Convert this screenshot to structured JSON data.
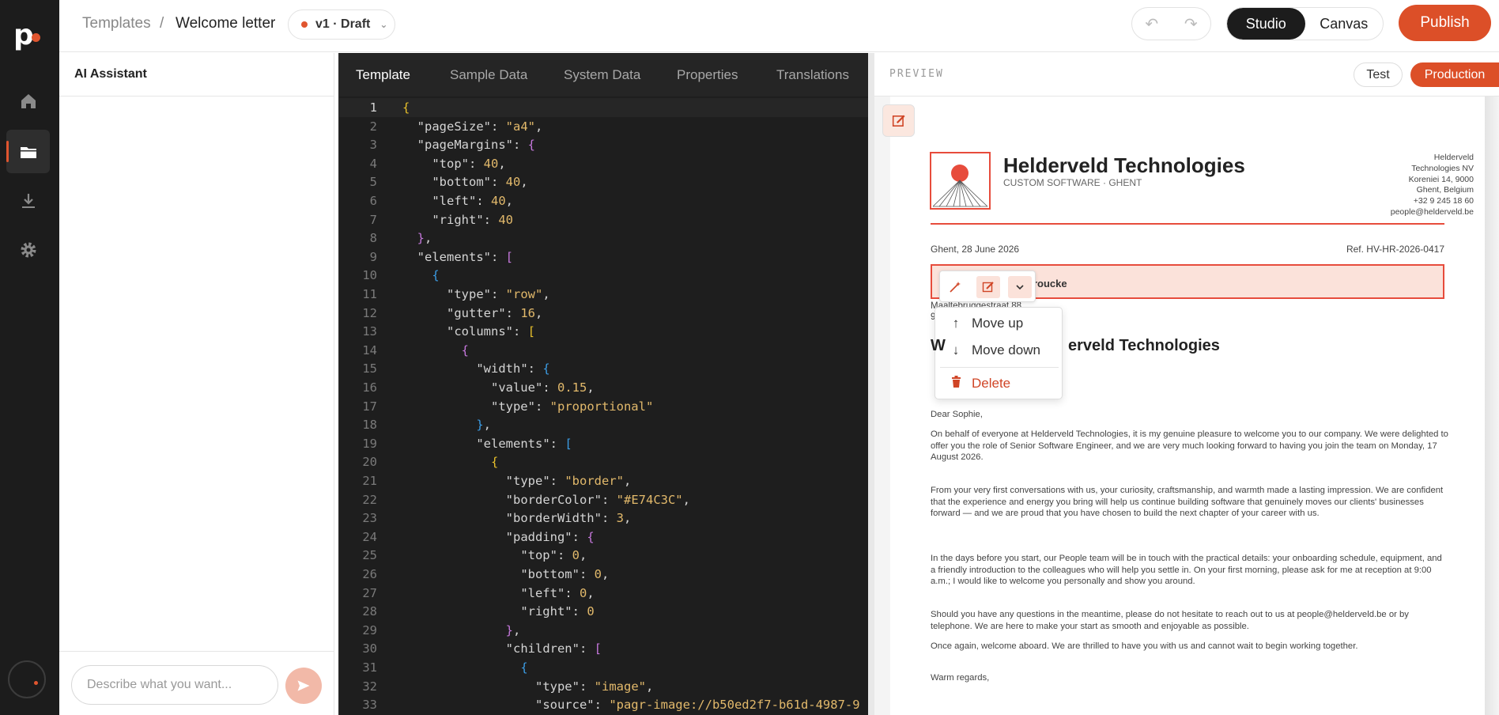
{
  "breadcrumb": {
    "root": "Templates",
    "separator": "/",
    "current": "Welcome letter"
  },
  "version": {
    "label": "v1 · Draft",
    "status_color": "#e0552f"
  },
  "mode_toggle": {
    "studio": "Studio",
    "canvas": "Canvas",
    "active": "Studio"
  },
  "publish_label": "Publish",
  "ai_panel": {
    "title": "AI Assistant",
    "input_placeholder": "Describe what you want..."
  },
  "editor": {
    "tabs": [
      "Template",
      "Sample Data",
      "System Data",
      "Properties",
      "Translations"
    ],
    "active_tab": "Template",
    "lines": [
      "{",
      "  \"pageSize\": \"a4\",",
      "  \"pageMargins\": {",
      "    \"top\": 40,",
      "    \"bottom\": 40,",
      "    \"left\": 40,",
      "    \"right\": 40",
      "  },",
      "  \"elements\": [",
      "    {",
      "      \"type\": \"row\",",
      "      \"gutter\": 16,",
      "      \"columns\": [",
      "        {",
      "          \"width\": {",
      "            \"value\": 0.15,",
      "            \"type\": \"proportional\"",
      "          },",
      "          \"elements\": [",
      "            {",
      "              \"type\": \"border\",",
      "              \"borderColor\": \"#E74C3C\",",
      "              \"borderWidth\": 3,",
      "              \"padding\": {",
      "                \"top\": 0,",
      "                \"bottom\": 0,",
      "                \"left\": 0,",
      "                \"right\": 0",
      "              },",
      "              \"children\": [",
      "                {",
      "                  \"type\": \"image\",",
      "                  \"source\": \"pagr-image://b50ed2f7-b61d-4987-9"
    ]
  },
  "preview": {
    "label": "PREVIEW",
    "env_test": "Test",
    "env_production": "Production",
    "letter": {
      "company": "Helderveld Technologies",
      "tagline": "CUSTOM SOFTWARE · GHENT",
      "address_lines": [
        "Helderveld",
        "Technologies NV",
        "Koreniei 14, 9000",
        "Ghent, Belgium",
        "+32 9 245 18 60",
        "people@helderveld.be"
      ],
      "date": "Ghent, 28 June 2026",
      "reference": "Ref. HV-HR-2026-0417",
      "recipient_name": "broucke",
      "recipient_street": "Maaltebruggestraat 88",
      "recipient_city": "9",
      "heading_left": "W",
      "heading": "erveld Technologies",
      "salutation": "Dear Sophie,",
      "paragraphs": [
        "On behalf of everyone at Helderveld Technologies, it is my genuine pleasure to welcome you to our company. We were delighted to offer you the role of Senior Software Engineer, and we are very much looking forward to having you join the team on Monday, 17 August 2026.",
        "From your very first conversations with us, your curiosity, craftsmanship, and warmth made a lasting impression. We are confident that the experience and energy you bring will help us continue building software that genuinely moves our clients' businesses forward — and we are proud that you have chosen to build the next chapter of your career with us.",
        "In the days before you start, our People team will be in touch with the practical details: your onboarding schedule, equipment, and a friendly introduction to the colleagues who will help you settle in. On your first morning, please ask for me at reception at 9:00 a.m.; I would like to welcome you personally and show you around.",
        "Should you have any questions in the meantime, please do not hesitate to reach out to us at people@helderveld.be or by telephone. We are here to make your start as smooth and enjoyable as possible.",
        "Once again, welcome aboard. We are thrilled to have you with us and cannot wait to begin working together.",
        "Warm regards,"
      ]
    },
    "context_menu": {
      "move_up": "Move up",
      "move_down": "Move down",
      "delete": "Delete"
    }
  },
  "accent_color": "#dc4f28"
}
